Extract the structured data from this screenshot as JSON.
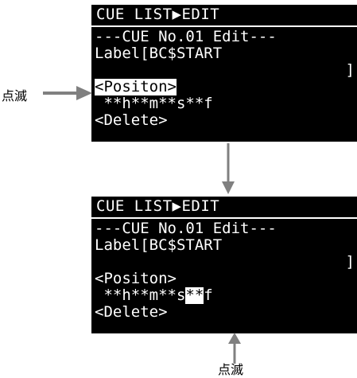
{
  "screen1": {
    "title": "CUE LIST▶EDIT",
    "lines": [
      "---CUE No.01 Edit---",
      "Label[BC$START",
      "]",
      "<Positon>",
      " **h**m**s**f",
      "<Delete>"
    ]
  },
  "screen2": {
    "title": "CUE LIST▶EDIT",
    "lines": [
      "---CUE No.01 Edit---",
      "Label[BC$START",
      "]",
      "<Positon>",
      " **h**m**s",
      "<Delete>"
    ],
    "highlight": "**",
    "suffix": "f"
  },
  "annotations": {
    "blink_left": "点滅",
    "blink_bottom": "点滅"
  },
  "colors": {
    "screen_bg": "#000000",
    "screen_fg": "#ffffff",
    "arrow": "#808080"
  }
}
